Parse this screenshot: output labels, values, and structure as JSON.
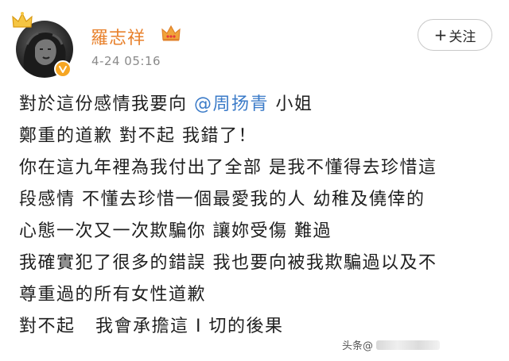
{
  "post": {
    "username": "羅志祥",
    "timestamp": "4-24 05:16",
    "follow_label": "关注",
    "follow_plus": "+",
    "content": {
      "line1_before": "對於這份感情我要向 ",
      "line1_mention": "@周扬青",
      "line1_after": " 小姐",
      "line2": "鄭重的道歉 對不起 我錯了！",
      "line3": "你在這九年裡為我付出了全部 是我不懂得去珍惜這",
      "line4": "段感情 不懂去珍惜一個最愛我的人 幼稚及僥倖的",
      "line5": "心態一次又一次欺騙你 讓妳受傷 難過",
      "line6": "我確實犯了很多的錯誤 我也要向被我欺騙過以及不",
      "line7": "尊重過的所有女性道歉",
      "line8": "對不起   我會承擔這 I 切的後果"
    },
    "watermark_text": "头条@"
  },
  "colors": {
    "username": "#e8812c",
    "mention": "#3b7bc8",
    "verified_badge": "#f6a623",
    "timestamp": "#8a8a8a"
  },
  "icons": {
    "avatar_badge": "gold-crown-icon",
    "verified": "verified-v-icon",
    "vip": "vip-crown-icon"
  }
}
